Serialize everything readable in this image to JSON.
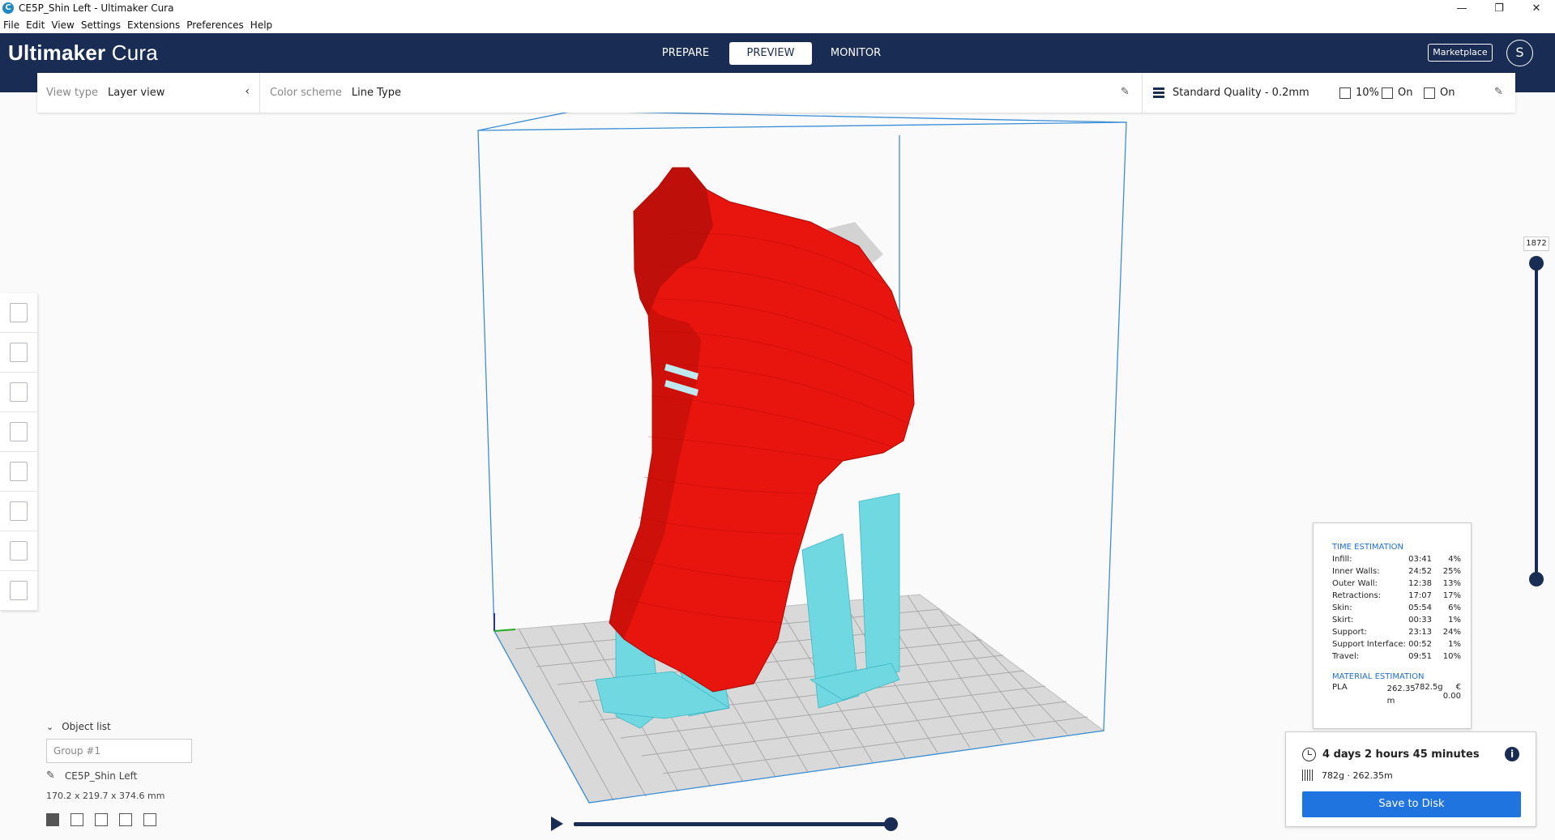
{
  "window": {
    "title": "CE5P_Shin Left - Ultimaker Cura",
    "minimize": "—",
    "restore": "❐",
    "close": "✕"
  },
  "menu": [
    "File",
    "Edit",
    "View",
    "Settings",
    "Extensions",
    "Preferences",
    "Help"
  ],
  "header": {
    "logo_bold": "Ultimaker",
    "logo_light": " Cura",
    "stages": [
      "PREPARE",
      "PREVIEW",
      "MONITOR"
    ],
    "active_stage": "PREVIEW",
    "marketplace_label": "Marketplace",
    "avatar_initial": "S"
  },
  "toolbar": {
    "view_type_label": "View type",
    "view_type_value": "Layer view",
    "color_scheme_label": "Color scheme",
    "color_scheme_value": "Line Type",
    "quality": "Standard Quality - 0.2mm",
    "infill": "10%",
    "support": "On",
    "adhesion": "On"
  },
  "tools": [
    "move-tool",
    "scale-tool",
    "rotate-tool",
    "mirror-tool",
    "per-model-settings-tool",
    "support-blocker-tool",
    "lay-flat-tool",
    "extra-tool"
  ],
  "object_list": {
    "header": "Object list",
    "group": "Group #1",
    "object_name": "CE5P_Shin Left",
    "dimensions": "170.2 x 219.7 x 374.6 mm"
  },
  "layer_slider": {
    "current_layer": "1872"
  },
  "estimation": {
    "time_header": "TIME ESTIMATION",
    "rows": [
      {
        "name": "Infill:",
        "time": "03:41",
        "pct": "4%"
      },
      {
        "name": "Inner Walls:",
        "time": "24:52",
        "pct": "25%"
      },
      {
        "name": "Outer Wall:",
        "time": "12:38",
        "pct": "13%"
      },
      {
        "name": "Retractions:",
        "time": "17:07",
        "pct": "17%"
      },
      {
        "name": "Skin:",
        "time": "05:54",
        "pct": "6%"
      },
      {
        "name": "Skirt:",
        "time": "00:33",
        "pct": "1%"
      },
      {
        "name": "Support:",
        "time": "23:13",
        "pct": "24%"
      },
      {
        "name": "Support Interface:",
        "time": "00:52",
        "pct": "1%"
      },
      {
        "name": "Travel:",
        "time": "09:51",
        "pct": "10%"
      }
    ],
    "material_header": "MATERIAL ESTIMATION",
    "material": {
      "name": "PLA",
      "length": "262.35 m",
      "weight": "782.5g",
      "cost": "€ 0.00"
    }
  },
  "print_panel": {
    "print_time": "4 days 2 hours 45 minutes",
    "material_summary": "782g · 262.35m",
    "save_label": "Save to Disk",
    "info_glyph": "i"
  },
  "colors": {
    "header_bg": "#192c53",
    "accent_blue": "#1f74e0",
    "model_red": "#e8140e",
    "support_cyan": "#6fd8e0"
  }
}
